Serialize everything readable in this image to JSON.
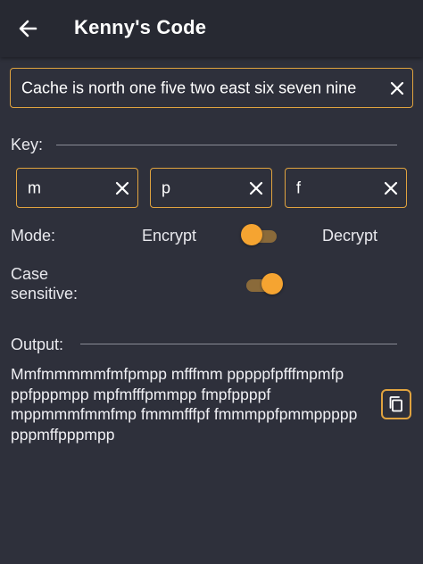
{
  "app_bar": {
    "title": "Kenny's Code",
    "back_icon": "arrow-left-icon"
  },
  "message": {
    "value": "Cache is north one five two east six seven nine",
    "clear_icon": "close-icon"
  },
  "key": {
    "label": "Key:",
    "fields": [
      {
        "value": "m",
        "clear_icon": "close-icon"
      },
      {
        "value": "p",
        "clear_icon": "close-icon"
      },
      {
        "value": "f",
        "clear_icon": "close-icon"
      }
    ]
  },
  "mode": {
    "label": "Mode:",
    "encrypt_label": "Encrypt",
    "decrypt_label": "Decrypt",
    "state": "encrypt"
  },
  "case_sensitive": {
    "label_line1": "Case",
    "label_line2": "sensitive:",
    "on": true
  },
  "output": {
    "label": "Output:",
    "text": "Mmfmmmmmfmfpmpp mfffmm pppppfpfffmpmfp ppfpppmpp mpfmfffpmmpp fmpfppppf mppmmmfmmfmp fmmmfffpf fmmmppfpmmppppp pppmffpppmpp",
    "copy_icon": "copy-icon"
  },
  "colors": {
    "accent": "#e0a33f",
    "background": "#2e303b",
    "appbar": "#272932"
  }
}
